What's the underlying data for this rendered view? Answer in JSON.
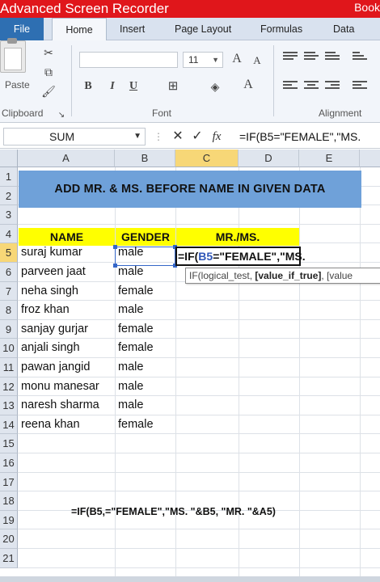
{
  "titlebar": {
    "app_title": "Advanced Screen Recorder",
    "book_title": "Book"
  },
  "ribbon_tabs": [
    {
      "label": "File"
    },
    {
      "label": "Home"
    },
    {
      "label": "Insert"
    },
    {
      "label": "Page Layout"
    },
    {
      "label": "Formulas"
    },
    {
      "label": "Data"
    }
  ],
  "ribbon": {
    "paste_label": "Paste",
    "font_size_value": "11",
    "group_labels": {
      "clipboard": "Clipboard",
      "font": "Font",
      "alignment": "Alignment"
    },
    "font_buttons": {
      "bold": "B",
      "italic": "I",
      "underline": "U",
      "grow_font": "A",
      "shrink_font": "A",
      "font_color": "A"
    }
  },
  "formula_bar": {
    "name_box": "SUM",
    "cancel_symbol": "✕",
    "enter_symbol": "✓",
    "fx_label": "fx",
    "formula": "=IF(B5=\"FEMALE\",\"MS."
  },
  "columns": [
    "A",
    "B",
    "C",
    "D",
    "E"
  ],
  "rows": [
    "1",
    "2",
    "3",
    "4",
    "5",
    "6",
    "7",
    "8",
    "9",
    "10",
    "11",
    "12",
    "13",
    "14",
    "15",
    "16",
    "17",
    "18",
    "19",
    "20",
    "21"
  ],
  "sheet": {
    "banner": "ADD MR. & MS. BEFORE NAME IN GIVEN DATA",
    "headers": {
      "name": "NAME",
      "gender": "GENDER",
      "title": "MR./MS."
    },
    "records": [
      {
        "name": "suraj kumar",
        "gender": "male"
      },
      {
        "name": "parveen jaat",
        "gender": "male"
      },
      {
        "name": "neha singh",
        "gender": "female"
      },
      {
        "name": "froz khan",
        "gender": "male"
      },
      {
        "name": "sanjay gurjar",
        "gender": "female"
      },
      {
        "name": "anjali singh",
        "gender": "female"
      },
      {
        "name": "pawan jangid",
        "gender": "male"
      },
      {
        "name": "monu manesar",
        "gender": "male"
      },
      {
        "name": "naresh sharma",
        "gender": "male"
      },
      {
        "name": "reena khan",
        "gender": "female"
      }
    ],
    "editing": {
      "prefix": "=IF(",
      "ref": "B5",
      "suffix": "=\"FEMALE\",\"MS."
    },
    "tooltip": {
      "fn": "IF(logical_test, ",
      "bold_arg": "[value_if_true]",
      "rest": ", [value"
    },
    "caption": "=IF(B5,=\"FEMALE\",\"MS. \"&B5, \"MR. \"&A5)"
  },
  "colors": {
    "title_bar": "#e0161b",
    "file_tab": "#2e6fb2",
    "banner": "#6fa1d9",
    "header_fill": "#ffff00",
    "active_header": "#f7d777",
    "ref_blue": "#3466c8"
  }
}
